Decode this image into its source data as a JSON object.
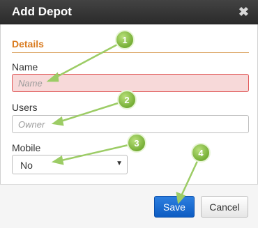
{
  "dialog": {
    "title": "Add Depot",
    "close_glyph": "✖",
    "section_title": "Details"
  },
  "fields": {
    "name_label": "Name",
    "name_placeholder": "Name",
    "users_label": "Users",
    "users_placeholder": "Owner",
    "mobile_label": "Mobile",
    "mobile_value": "No",
    "mobile_caret": "▼"
  },
  "buttons": {
    "save": "Save",
    "cancel": "Cancel"
  },
  "callouts": [
    "1",
    "2",
    "3",
    "4"
  ],
  "colors": {
    "section_accent": "#d97b1f",
    "error_field": "#f7d9d9",
    "primary_button": "#1a6fd6",
    "callout_green": "#8bc34a"
  }
}
